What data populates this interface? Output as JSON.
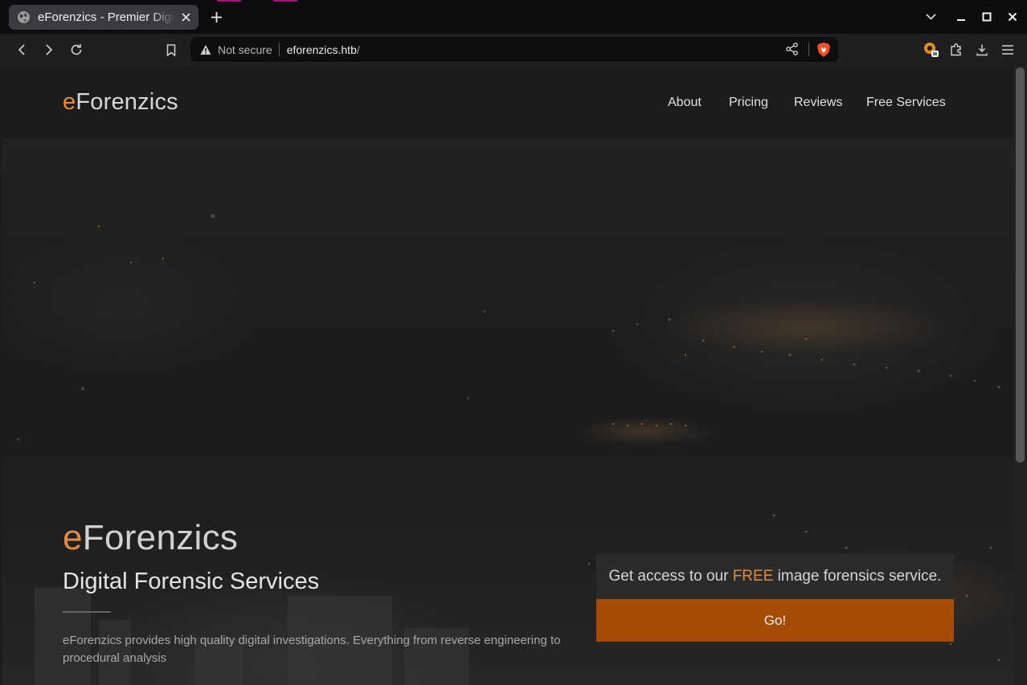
{
  "browser": {
    "tab": {
      "title": "eForenzics - Premier Digital Forensics",
      "icon": "globe-icon"
    },
    "new_tab_icon": "plus-icon",
    "window_controls": [
      "tab-list-chevron-icon",
      "minimize-icon",
      "maximize-icon",
      "close-icon"
    ],
    "nav_icons": [
      "back-icon",
      "forward-icon",
      "reload-icon",
      "bookmark-icon"
    ],
    "address": {
      "security_label": "Not secure",
      "host": "eforenzics.htb",
      "path": "/"
    },
    "right_icons": [
      "brave-rewards-icon",
      "extensions-icon",
      "downloads-icon",
      "menu-icon"
    ],
    "accent_color": "#a0197a"
  },
  "site": {
    "brand": {
      "e": "e",
      "rest": "Forenzics"
    },
    "nav": [
      {
        "label": "About"
      },
      {
        "label": "Pricing"
      },
      {
        "label": "Reviews"
      },
      {
        "label": "Free Services"
      }
    ],
    "hero": {
      "title_e": "e",
      "title_rest": "Forenzics",
      "subtitle": "Digital Forensic Services",
      "description": "eForenzics provides high quality digital investigations. Everything from reverse engineering to procedural analysis"
    },
    "promo": {
      "text_before": "Get access to our ",
      "text_highlight": "FREE",
      "text_after": " image forensics service.",
      "button_label": "Go!"
    },
    "colors": {
      "brand_orange": "#ee8c3d",
      "button_bg": "#a34c02"
    }
  }
}
